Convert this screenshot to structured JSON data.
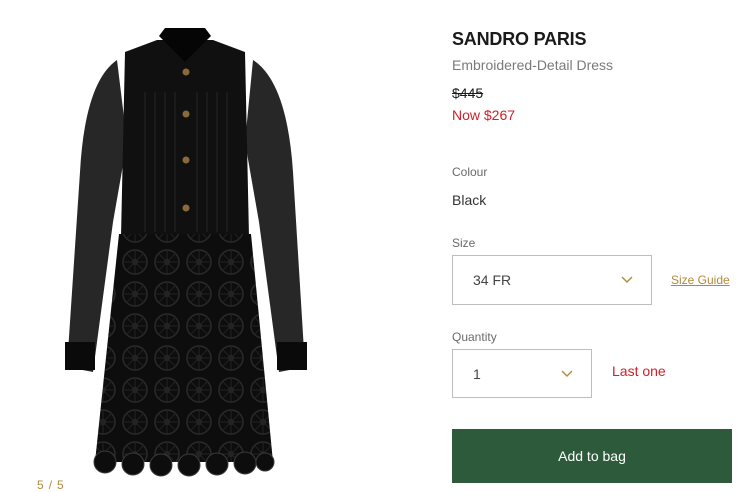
{
  "gallery": {
    "current": "5",
    "separator": "/",
    "total": "5"
  },
  "product": {
    "brand": "SANDRO PARIS",
    "name": "Embroidered-Detail Dress",
    "price_was": "$445",
    "price_now": "Now $267"
  },
  "colour": {
    "label": "Colour",
    "value": "Black"
  },
  "size": {
    "label": "Size",
    "value": "34 FR",
    "guide_label": "Size Guide"
  },
  "quantity": {
    "label": "Quantity",
    "value": "1",
    "stock_note": "Last one"
  },
  "actions": {
    "add_to_bag": "Add to bag"
  },
  "colors": {
    "accent_gold": "#b38a3a",
    "sale_red": "#d0202a",
    "button_green": "#2e5a3c"
  }
}
